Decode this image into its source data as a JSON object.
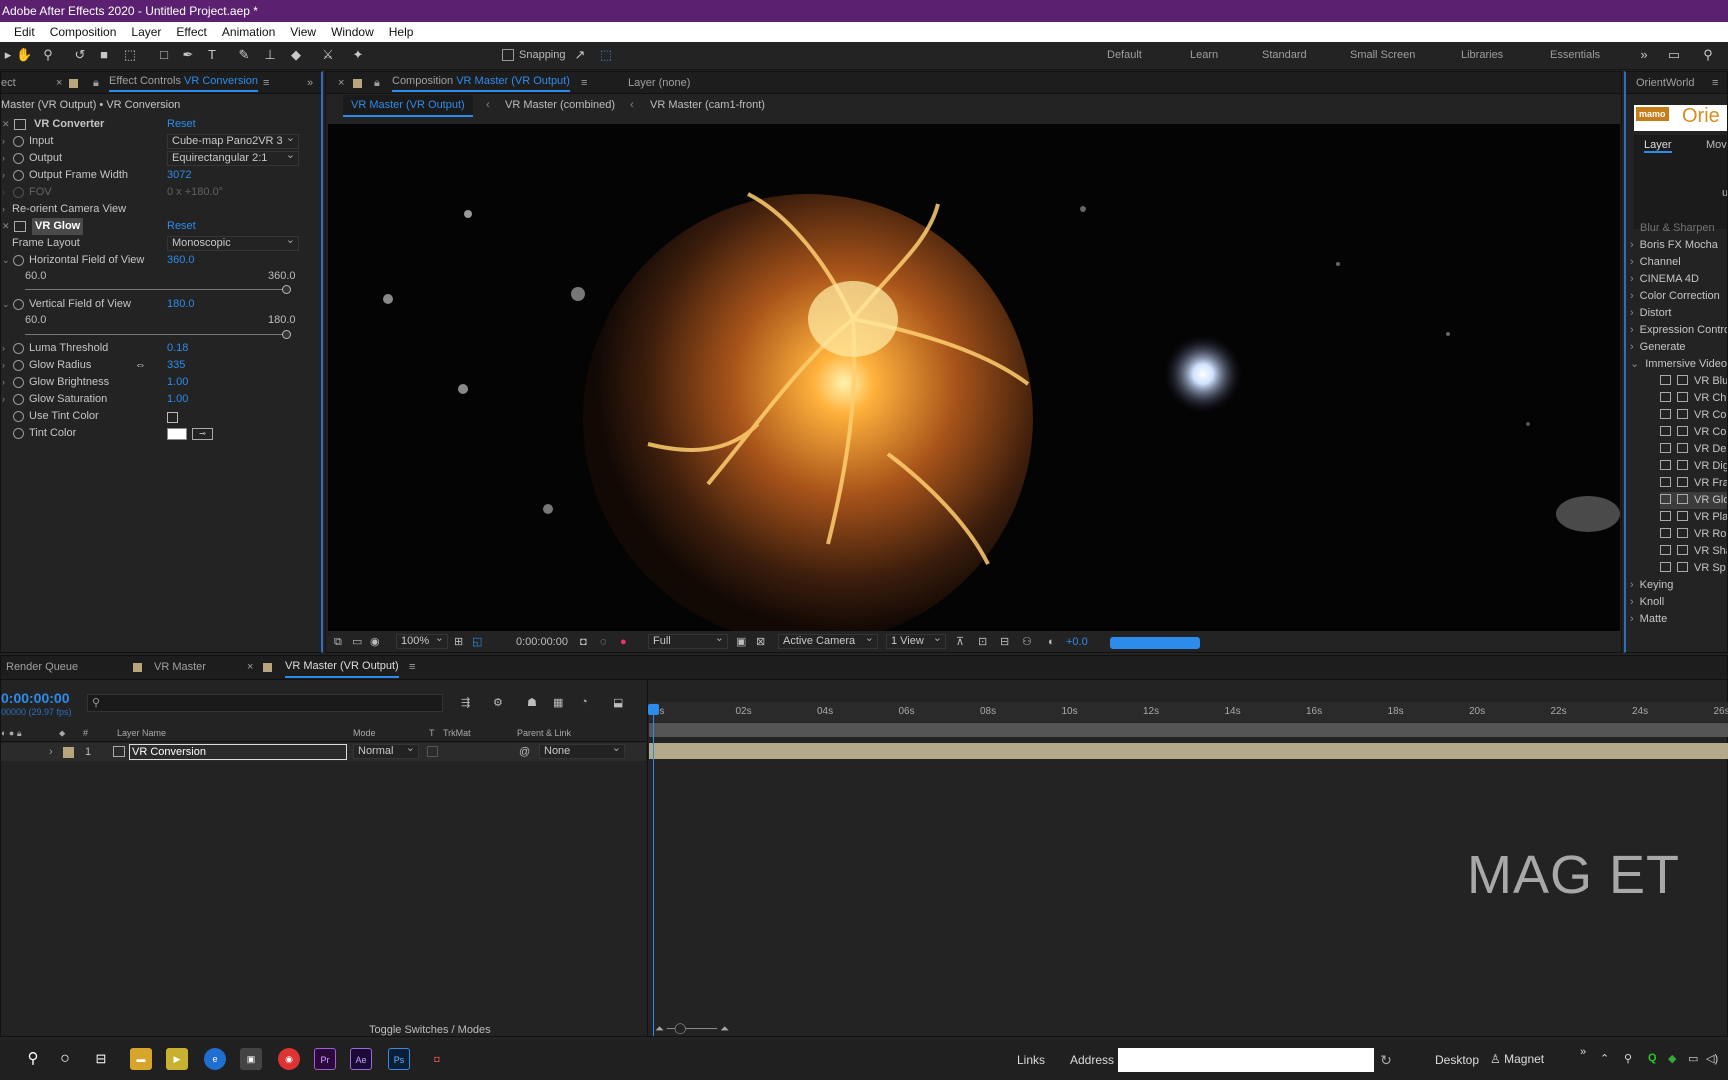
{
  "app": {
    "title": "Adobe After Effects 2020 - Untitled Project.aep *"
  },
  "menu": [
    "Edit",
    "Composition",
    "Layer",
    "Effect",
    "Animation",
    "View",
    "Window",
    "Help"
  ],
  "toolbar": {
    "snapping": "Snapping",
    "workspaces": [
      "Default",
      "Learn",
      "Standard",
      "Small Screen",
      "Libraries",
      "Essentials"
    ]
  },
  "effect_panel": {
    "tab_left": "ect",
    "tab_label": "Effect Controls",
    "tab_target": "VR Conversion",
    "breadcrumb": "Master (VR Output) • VR Conversion",
    "fx1": {
      "name": "VR Converter",
      "reset": "Reset",
      "input_label": "Input",
      "input_value": "Cube-map Pano2VR 3",
      "output_label": "Output",
      "output_value": "Equirectangular 2:1",
      "width_label": "Output Frame Width",
      "width_value": "3072",
      "fov_label": "FOV",
      "fov_value": "0 x +180.0°",
      "reorient_label": "Re-orient Camera View"
    },
    "fx2": {
      "name": "VR Glow",
      "reset": "Reset",
      "frame_layout_label": "Frame Layout",
      "frame_layout_value": "Monoscopic",
      "hfov_label": "Horizontal Field of View",
      "hfov_value": "360.0",
      "hfov_min": "60.0",
      "hfov_max": "360.0",
      "vfov_label": "Vertical Field of View",
      "vfov_value": "180.0",
      "vfov_min": "60.0",
      "vfov_max": "180.0",
      "luma_label": "Luma Threshold",
      "luma_value": "0.18",
      "radius_label": "Glow Radius",
      "radius_value": "335",
      "brightness_label": "Glow Brightness",
      "brightness_value": "1.00",
      "saturation_label": "Glow Saturation",
      "saturation_value": "1.00",
      "use_tint_label": "Use Tint Color",
      "tint_label": "Tint Color"
    }
  },
  "composition": {
    "tab_label": "Composition",
    "tab_target": "VR Master (VR Output)",
    "layer_tab": "Layer  (none)",
    "crumbs": [
      "VR Master (VR Output)",
      "VR Master (combined)",
      "VR Master (cam1-front)"
    ],
    "zoom": "100%",
    "timecode": "0:00:00:00",
    "resolution": "Full",
    "camera": "Active Camera",
    "views": "1 View",
    "exposure": "+0.0"
  },
  "right_panel": {
    "title": "OrientWorld",
    "logo": "mamo",
    "logo_title": "Orie",
    "tabs": [
      "Layer",
      "Mov"
    ],
    "note": "use",
    "effects_top": "Blur & Sharpen",
    "effects": [
      "Boris FX Mocha",
      "Channel",
      "CINEMA 4D",
      "Color Correction",
      "Distort",
      "Expression Controls",
      "Generate",
      "Immersive Video"
    ],
    "immersive": [
      "VR Blu",
      "VR Ch",
      "VR Co",
      "VR Co",
      "VR De",
      "VR Dig",
      "VR Fra",
      "VR Glo",
      "VR Pla",
      "VR Ro",
      "VR Sha",
      "VR Sp"
    ],
    "effects_after": [
      "Keying",
      "Knoll",
      "Matte"
    ]
  },
  "timeline": {
    "tabs": [
      "Render Queue",
      "VR Master",
      "VR Master (VR Output)"
    ],
    "timecode": "0:00:00:00",
    "fps": "00000 (29.97 fps)",
    "headers": [
      "#",
      "Layer Name",
      "Mode",
      "T",
      "TrkMat",
      "Parent & Link"
    ],
    "layer": {
      "index": "1",
      "name": "VR Conversion",
      "mode": "Normal",
      "parent": "None"
    },
    "ruler": [
      "0s",
      "02s",
      "04s",
      "06s",
      "08s",
      "10s",
      "12s",
      "14s",
      "16s",
      "18s",
      "20s",
      "22s",
      "24s",
      "26s"
    ],
    "toggle": "Toggle Switches / Modes",
    "watermark": "MAG ET"
  },
  "taskbar": {
    "links": "Links",
    "address": "Address",
    "desktop": "Desktop",
    "magnet": "Magnet",
    "apps": [
      "Pr",
      "Ae",
      "Ps"
    ]
  }
}
